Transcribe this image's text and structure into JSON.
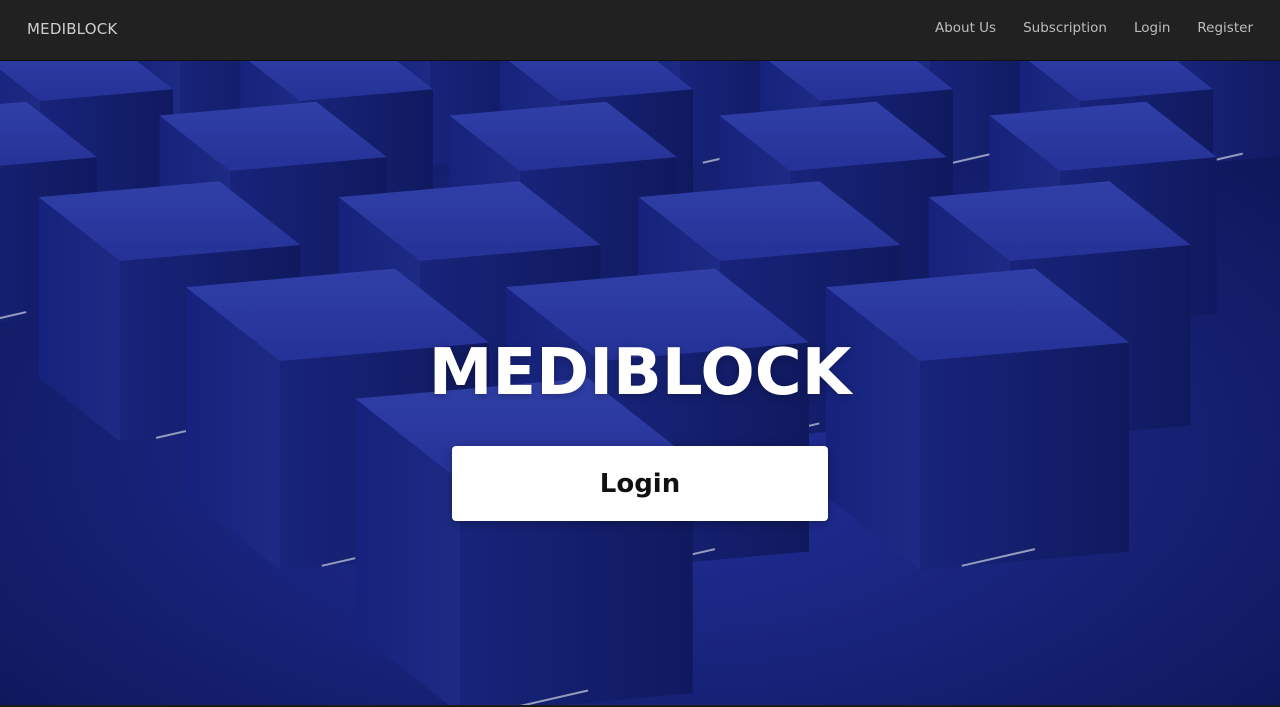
{
  "navbar": {
    "brand": "MEDIBLOCK",
    "links": [
      {
        "label": "About Us"
      },
      {
        "label": "Subscription"
      },
      {
        "label": "Login"
      },
      {
        "label": "Register"
      }
    ]
  },
  "hero": {
    "title": "MEDIBLOCK",
    "login_button": "Login",
    "background_description_icon": "tezos-icon"
  },
  "colors": {
    "navbar_bg": "#212121",
    "hero_blue": "#1a28a0",
    "button_bg": "#ffffff"
  }
}
